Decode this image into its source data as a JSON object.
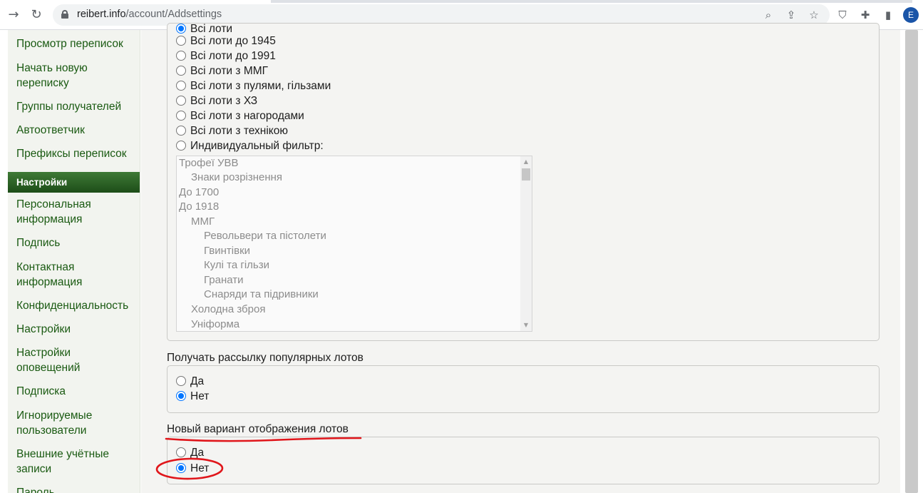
{
  "browser": {
    "url_host": "reibert.info",
    "url_path": "/account/Addsettings",
    "profile_initial": "E"
  },
  "sidebar": {
    "items_top": [
      "Просмотр переписок",
      "Начать новую переписку",
      "Группы получателей",
      "Автоответчик",
      "Префиксы переписок"
    ],
    "section_header": "Настройки",
    "items_settings": [
      "Персональная информация",
      "Подпись",
      "Контактная информация",
      "Конфиденциальность",
      "Настройки",
      "Настройки оповещений",
      "Подписка",
      "Игнорируемые пользователи",
      "Внешние учётные записи",
      "Пароль"
    ]
  },
  "lot_filter": {
    "partial_top_option": "Всі лоти",
    "options": [
      "Всі лоти до 1945",
      "Всі лоти до 1991",
      "Всі лоти з ММГ",
      "Всі лоти з пулями, гільзами",
      "Всі лоти з ХЗ",
      "Всі лоти з нагородами",
      "Всі лоти з технікою",
      "Индивидуальный фильтр:"
    ],
    "category_list": [
      {
        "label": "Трофеї УВВ",
        "level": 0
      },
      {
        "label": "Знаки розрізнення",
        "level": 1
      },
      {
        "label": "До 1700",
        "level": 0
      },
      {
        "label": "До 1918",
        "level": 0
      },
      {
        "label": "ММГ",
        "level": 1
      },
      {
        "label": "Револьвери та пістолети",
        "level": 2
      },
      {
        "label": "Гвинтівки",
        "level": 2
      },
      {
        "label": "Кулі та гільзи",
        "level": 2
      },
      {
        "label": "Гранати",
        "level": 2
      },
      {
        "label": "Снаряди та підривники",
        "level": 2
      },
      {
        "label": "Холодна зброя",
        "level": 1
      },
      {
        "label": "Уніформа",
        "level": 1
      }
    ]
  },
  "popular_lots": {
    "label": "Получать рассылку популярных лотов",
    "option_yes": "Да",
    "option_no": "Нет",
    "selected": "no"
  },
  "new_lot_view": {
    "label": "Новый вариант отображения лотов",
    "option_yes": "Да",
    "option_no": "Нет",
    "selected": "no"
  },
  "colors": {
    "link_green": "#1a5a12",
    "header_green": "#2e6427",
    "annotation_red": "#e0161b",
    "radio_blue": "#0075ff"
  }
}
